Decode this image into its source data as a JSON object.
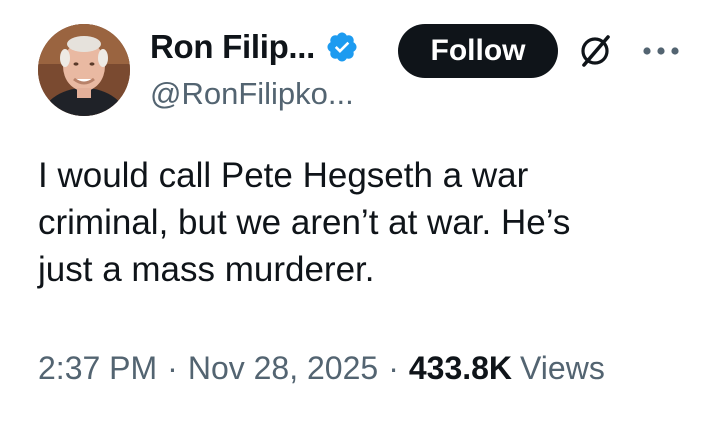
{
  "author": {
    "display_name": "Ron Filip...",
    "handle": "@RonFilipko..."
  },
  "actions": {
    "follow_label": "Follow"
  },
  "icons": {
    "verified": "verified-badge-icon",
    "grok": "grok-icon",
    "more": "more-options-icon"
  },
  "tweet": {
    "text_lines": [
      "I would call Pete Hegseth a war",
      "criminal, but we aren’t at war. He’s",
      "just a mass murderer."
    ],
    "time": "2:37 PM",
    "separator": "·",
    "date": "Nov 28, 2025",
    "views_count": "433.8K",
    "views_label": "Views"
  },
  "colors": {
    "verified_blue": "#1d9bf0",
    "text_primary": "#0f1419",
    "text_secondary": "#536471",
    "follow_bg": "#0f1419"
  }
}
